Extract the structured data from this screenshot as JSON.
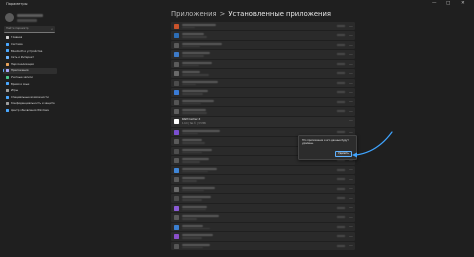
{
  "window": {
    "title": "Параметры",
    "controls": {
      "minimize": "—",
      "maximize": "□",
      "close": "✕"
    }
  },
  "sidebar": {
    "search_placeholder": "Найти параметр",
    "items": [
      {
        "label": "Главная",
        "icon": "home-icon",
        "color": "#d4d4d4"
      },
      {
        "label": "Система",
        "icon": "system-icon",
        "color": "#4aa8ff"
      },
      {
        "label": "Bluetooth и устройства",
        "icon": "bluetooth-icon",
        "color": "#4aa8ff"
      },
      {
        "label": "Сеть и Интернет",
        "icon": "network-icon",
        "color": "#6fb7ff"
      },
      {
        "label": "Персонализация",
        "icon": "brush-icon",
        "color": "#e6a15a"
      },
      {
        "label": "Приложения",
        "icon": "apps-icon",
        "color": "#a9a9ff",
        "selected": true
      },
      {
        "label": "Учетные записи",
        "icon": "account-icon",
        "color": "#4ac98a"
      },
      {
        "label": "Время и язык",
        "icon": "globe-icon",
        "color": "#4aa8ff"
      },
      {
        "label": "Игры",
        "icon": "gamepad-icon",
        "color": "#9f9f9f"
      },
      {
        "label": "Специальные возможности",
        "icon": "accessibility-icon",
        "color": "#4aa8ff"
      },
      {
        "label": "Конфиденциальность и защита",
        "icon": "shield-icon",
        "color": "#9f9f9f"
      },
      {
        "label": "Центр обновления Windows",
        "icon": "update-icon",
        "color": "#4aa8ff"
      }
    ]
  },
  "breadcrumb": {
    "parent": "Приложения",
    "separator": ">",
    "current": "Установленные приложения"
  },
  "apps": {
    "rows_before": [
      {
        "color": "#c9532b"
      },
      {
        "color": "#2d6db5"
      },
      {
        "color": "#5a5a5a"
      },
      {
        "color": "#3d7ac7"
      },
      {
        "color": "#5b5b5b"
      },
      {
        "color": "#6a6a6a"
      },
      {
        "color": "#4c4c4c"
      },
      {
        "color": "#3a7bd5"
      },
      {
        "color": "#555555"
      },
      {
        "color": "#5f5f5f"
      }
    ],
    "expanded_row": {
      "name": "RAM Cacher X",
      "details": "1.0.0 | Yes © | 3.5 МБ",
      "more_icon": "…"
    },
    "rows_after": [
      {
        "color": "#7b4fd1"
      },
      {
        "color": "#5a5a5a"
      },
      {
        "color": "#4e4e4e"
      },
      {
        "color": "#5a5a5a"
      },
      {
        "color": "#3f86d8"
      },
      {
        "color": "#5a5a5a"
      },
      {
        "color": "#6a6a6a"
      },
      {
        "color": "#4c4c4c"
      },
      {
        "color": "#8b5bd6"
      },
      {
        "color": "#5a5a5a"
      },
      {
        "color": "#3b7fd0"
      },
      {
        "color": "#8a4fc9"
      },
      {
        "color": "#555555"
      }
    ]
  },
  "popup": {
    "message": "Это приложение и его данные будут удалены.",
    "button": "Удалить"
  },
  "colors": {
    "accent": "#5fb2ff",
    "arrow": "#3fa4ff"
  }
}
